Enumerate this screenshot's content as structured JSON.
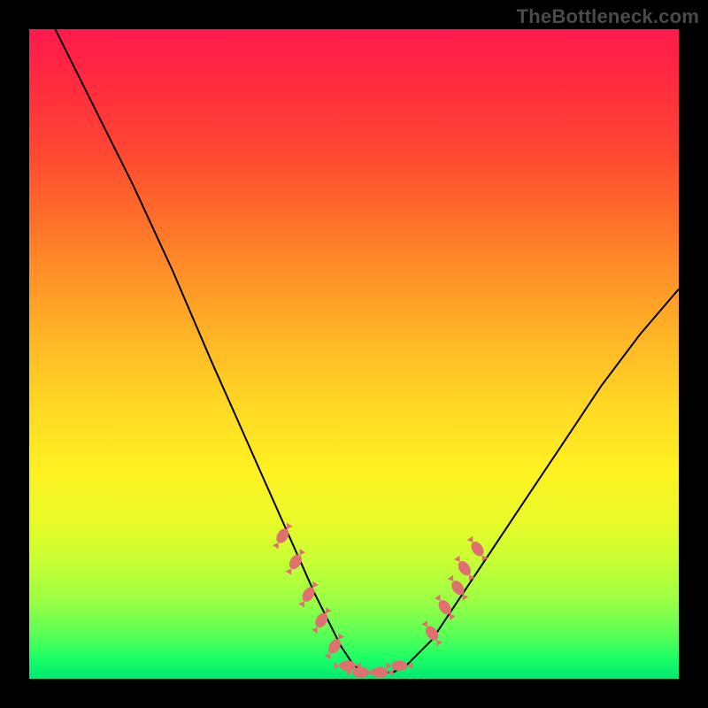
{
  "watermark": "TheBottleneck.com",
  "colors": {
    "frame": "#000000",
    "curve": "#000000",
    "marker": "#e07070",
    "gradient_top": "#ff1a4d",
    "gradient_bottom": "#00e874"
  },
  "chart_data": {
    "type": "line",
    "title": "",
    "xlabel": "",
    "ylabel": "",
    "xlim": [
      0,
      100
    ],
    "ylim": [
      0,
      100
    ],
    "grid": false,
    "legend": false,
    "note": "Axes are unlabeled; values are read as percent of plot width/height. y=0 is the bottom (green), y=100 is the top (red). The curve is an asymmetric V: steep descent on the left, flat trough around x≈48–58, gentler rise on the right.",
    "series": [
      {
        "name": "bottleneck-curve",
        "x": [
          4,
          10,
          16,
          22,
          28,
          32,
          36,
          40,
          44,
          48,
          50,
          52,
          54,
          56,
          58,
          62,
          66,
          70,
          76,
          82,
          88,
          94,
          100
        ],
        "y": [
          100,
          88,
          76,
          63,
          49,
          40,
          31,
          22,
          13,
          5,
          2,
          1,
          1,
          1,
          2,
          6,
          12,
          18,
          27,
          36,
          45,
          53,
          60
        ]
      }
    ],
    "markers": {
      "name": "highlighted-points",
      "note": "Pink lozenge markers clustered near the trough on both flanks.",
      "points": [
        {
          "x": 39,
          "y": 22
        },
        {
          "x": 41,
          "y": 18
        },
        {
          "x": 43,
          "y": 13
        },
        {
          "x": 45,
          "y": 9
        },
        {
          "x": 47,
          "y": 5
        },
        {
          "x": 49,
          "y": 2
        },
        {
          "x": 51,
          "y": 1
        },
        {
          "x": 54,
          "y": 1
        },
        {
          "x": 57,
          "y": 2
        },
        {
          "x": 62,
          "y": 7
        },
        {
          "x": 64,
          "y": 11
        },
        {
          "x": 66,
          "y": 14
        },
        {
          "x": 67,
          "y": 17
        },
        {
          "x": 69,
          "y": 20
        }
      ]
    }
  }
}
